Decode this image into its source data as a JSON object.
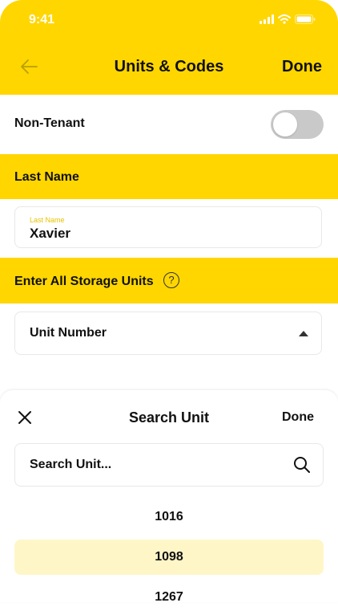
{
  "status_bar": {
    "time": "9:41"
  },
  "header": {
    "title": "Units & Codes",
    "done_label": "Done"
  },
  "non_tenant": {
    "label": "Non-Tenant",
    "enabled": false
  },
  "last_name_section": {
    "label": "Last Name"
  },
  "last_name_field": {
    "floating_label": "Last Name",
    "value": "Xavier"
  },
  "storage_section": {
    "label": "Enter All Storage Units",
    "help": "?"
  },
  "unit_select": {
    "value": "Unit Number"
  },
  "sheet": {
    "title": "Search Unit",
    "done_label": "Done",
    "search_placeholder": "Search Unit...",
    "options": [
      {
        "label": "1016",
        "selected": false
      },
      {
        "label": "1098",
        "selected": true
      },
      {
        "label": "1267",
        "selected": false
      }
    ]
  },
  "colors": {
    "accent": "#FFD600",
    "selected_row": "#FFF6C8",
    "toggle_off": "#C9C9C9"
  }
}
